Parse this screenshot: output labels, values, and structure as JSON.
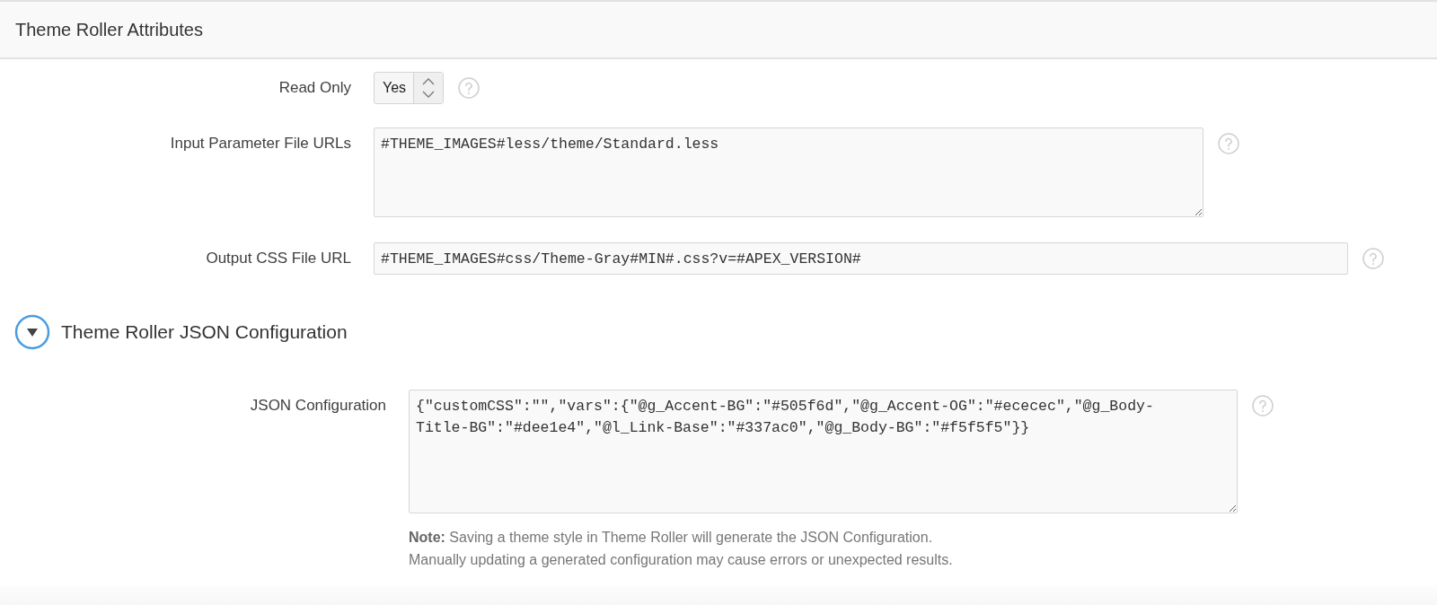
{
  "header": {
    "title": "Theme Roller Attributes"
  },
  "fields": [
    {
      "label": "Read Only",
      "kind": "select",
      "value": "Yes"
    },
    {
      "label": "Input Parameter File URLs",
      "kind": "textarea",
      "value": "#THEME_IMAGES#less/theme/Standard.less"
    },
    {
      "label": "Output CSS File URL",
      "kind": "text",
      "value": "#THEME_IMAGES#css/Theme-Gray#MIN#.css?v=#APEX_VERSION#"
    }
  ],
  "section": {
    "title": "Theme Roller JSON Configuration",
    "expanded": true,
    "fields": [
      {
        "label": "JSON Configuration",
        "kind": "textarea",
        "value": "{\"customCSS\":\"\",\"vars\":{\"@g_Accent-BG\":\"#505f6d\",\"@g_Accent-OG\":\"#ececec\",\"@g_Body-Title-BG\":\"#dee1e4\",\"@l_Link-Base\":\"#337ac0\",\"@g_Body-BG\":\"#f5f5f5\"}}"
      }
    ],
    "note_lines": [
      "**Note:** Saving a theme style in Theme Roller will generate the JSON Configuration.",
      "Manually updating a generated configuration may cause errors or unexpected results."
    ]
  }
}
